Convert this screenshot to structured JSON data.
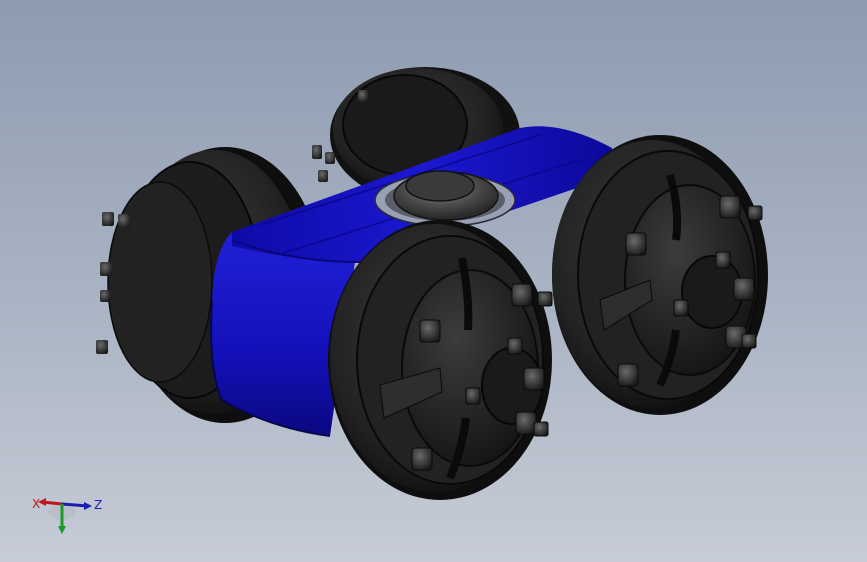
{
  "viewport": {
    "background_top": "#8e9bb0",
    "background_bottom": "#c7ccd6"
  },
  "model": {
    "body_color": "#1a14c8",
    "wheel_color": "#1c1c1c"
  },
  "triad": {
    "x_label": "X",
    "z_label": "Z",
    "x_color": "#c01818",
    "y_color": "#1a9a2a",
    "z_color": "#1820b0"
  }
}
